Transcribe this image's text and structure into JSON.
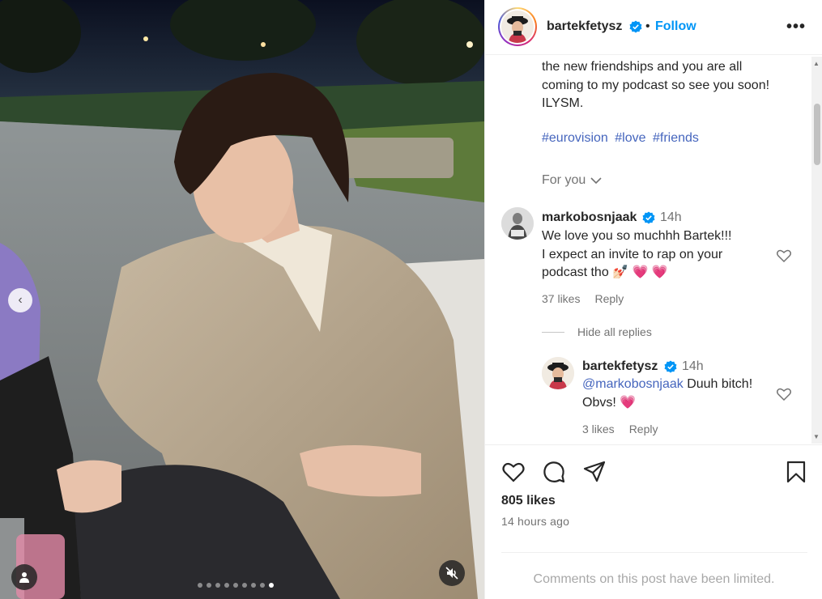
{
  "post": {
    "author": "bartekfetysz",
    "separator": "•",
    "follow_label": "Follow",
    "more_label": "•••"
  },
  "caption": {
    "line1": "the new friendships and you are all",
    "line2": "coming to my podcast so see you soon!",
    "line3": "ILYSM.",
    "hashtags": [
      "#eurovision",
      "#love",
      "#friends"
    ],
    "for_you": "For you"
  },
  "comments": [
    {
      "username": "markobosnjaak",
      "time": "14h",
      "line1": "We love you so muchhh Bartek!!!",
      "line2": "I expect an invite to rap on your",
      "line3": "podcast tho 💅🏻 💗 💗",
      "likes": "37 likes",
      "reply_label": "Reply",
      "hide_replies": "Hide all replies"
    },
    {
      "username": "bartekfetysz",
      "time": "14h",
      "mention": "@markobosnjaak",
      "line1_rest": " Duuh bitch!",
      "line2": "Obvs! 💗",
      "likes": "3 likes",
      "reply_label": "Reply"
    }
  ],
  "stats": {
    "likes": "805 likes",
    "time_ago": "14 hours ago"
  },
  "footer": {
    "limited": "Comments on this post have been limited."
  },
  "media": {
    "slide_count": 9,
    "active_slide": 9,
    "prev_label": "‹"
  },
  "colors": {
    "link": "#4565bd",
    "follow": "#0095f6",
    "verified": "#0095f6",
    "heart": "#ff3b7f"
  }
}
